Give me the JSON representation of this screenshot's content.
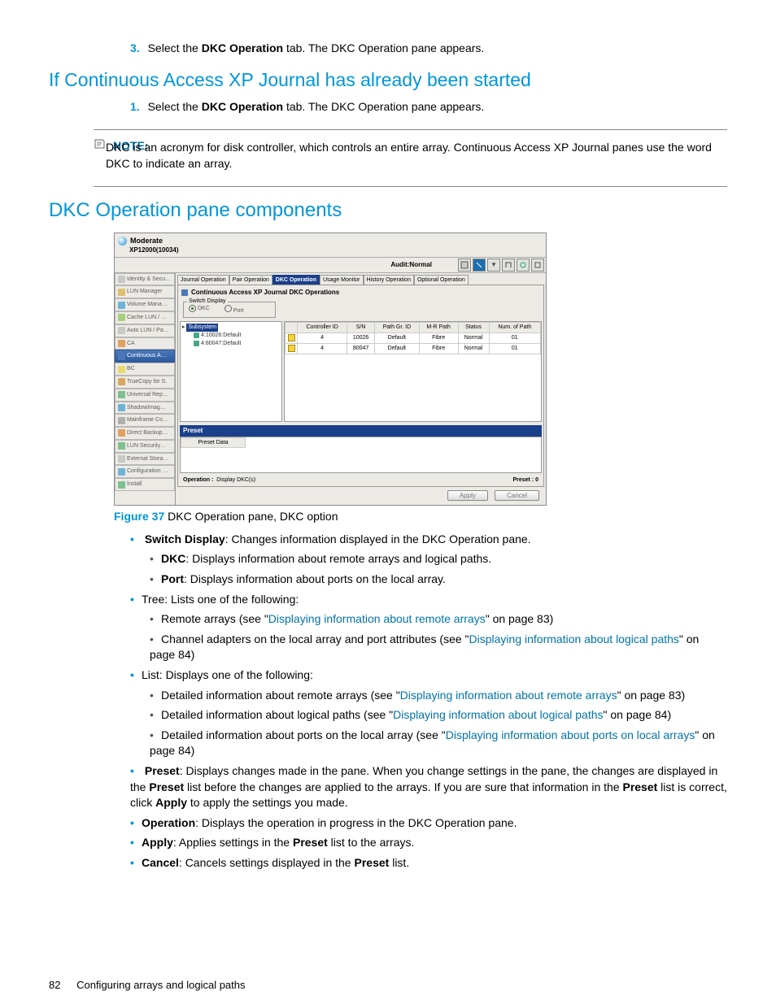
{
  "step3": {
    "num": "3.",
    "pre": "Select the ",
    "bold": "DKC Operation",
    "post": " tab. The DKC Operation pane appears."
  },
  "h2a": "If Continuous Access XP Journal has already been started",
  "step1": {
    "num": "1.",
    "pre": "Select the ",
    "bold": "DKC Operation",
    "post": " tab. The DKC Operation pane appears."
  },
  "note": {
    "label": "NOTE:",
    "text": "DKC is an acronym for disk controller, which controls an entire array. Continuous Access XP Journal panes use the word DKC to indicate an array."
  },
  "h2b": "DKC Operation pane components",
  "shot": {
    "title": "Moderate",
    "subtitle": "XP12000(10034)",
    "audit": "Audit:Normal",
    "nav": [
      "Identity & Secu…",
      "LUN Manager",
      "Volume Mana…",
      "Cache LUN / …",
      "Auto LUN / Pa…",
      "CA",
      "Continuous A…",
      "BC",
      "TrueCopy for S.",
      "Universal Rep…",
      "ShadowImag…",
      "Mainframe Co…",
      "Direct Backup…",
      "LUN Security…",
      "External Stora…",
      "Configuration …",
      "Install"
    ],
    "navActive": 6,
    "tabs": [
      "Journal Operation",
      "Pair Operation",
      "DKC Operation",
      "Usage Monitor",
      "History Operation",
      "Optional Operation"
    ],
    "tabActive": 2,
    "panelTitle": "Continuous Access XP Journal DKC Operations",
    "switch": {
      "legend": "Switch Display",
      "opts": [
        "DKC",
        "Port"
      ],
      "sel": 0
    },
    "tree": {
      "root": "Subsystem",
      "items": [
        "4:10026:Default",
        "4:80047:Default"
      ]
    },
    "table": {
      "cols": [
        "Controller ID",
        "S/N",
        "Path Gr. ID",
        "M-R Path",
        "Status",
        "Num. of Path"
      ],
      "rows": [
        [
          "4",
          "10026",
          "Default",
          "Fibre",
          "Normal",
          "01"
        ],
        [
          "4",
          "80047",
          "Default",
          "Fibre",
          "Normal",
          "01"
        ]
      ]
    },
    "preset": {
      "title": "Preset",
      "col": "Preset Data"
    },
    "op": {
      "l1": "Operation :",
      "l2": "Display DKC(s)",
      "r": "Preset : 0"
    },
    "buttons": {
      "apply": "Apply",
      "cancel": "Cancel"
    }
  },
  "figure": {
    "label": "Figure 37",
    "text": " DKC Operation pane, DKC option"
  },
  "bullets": {
    "switch": {
      "bold": "Switch Display",
      "text": ": Changes information displayed in the DKC Operation pane."
    },
    "dkc": {
      "bold": "DKC",
      "text": ": Displays information about remote arrays and logical paths."
    },
    "port": {
      "bold": "Port",
      "text": ": Displays information about ports on the local array."
    },
    "tree": "Tree: Lists one of the following:",
    "tree1": {
      "pre": "Remote arrays (see \"",
      "link": "Displaying information about remote arrays",
      "post": "\" on page 83)"
    },
    "tree2": {
      "pre": "Channel adapters on the local array and port attributes (see \"",
      "link": "Displaying information about logical paths",
      "post": "\" on page 84)"
    },
    "list": "List: Displays one of the following:",
    "list1": {
      "pre": "Detailed information about remote arrays (see \"",
      "link": "Displaying information about remote arrays",
      "post": "\" on page 83)"
    },
    "list2": {
      "pre": "Detailed information about logical paths (see \"",
      "link": "Displaying information about logical paths",
      "post": "\" on page 84)"
    },
    "list3": {
      "pre": "Detailed information about ports on the local array (see \"",
      "link": "Displaying information about ports on local arrays",
      "post": "\" on page 84)"
    },
    "preset": {
      "bold": "Preset",
      "text": ": Displays changes made in the pane. When you change settings in the pane, the changes are displayed in the ",
      "bold2": "Preset",
      "text2": " list before the changes are applied to the arrays. If you are sure that information in the ",
      "bold3": "Preset",
      "text3": " list is correct, click ",
      "bold4": "Apply",
      "text4": " to apply the settings you made."
    },
    "operation": {
      "bold": "Operation",
      "text": ": Displays the operation in progress in the DKC Operation pane."
    },
    "apply": {
      "bold": "Apply",
      "text": ": Applies settings in the ",
      "bold2": "Preset",
      "text2": " list to the arrays."
    },
    "cancel": {
      "bold": "Cancel",
      "text": ": Cancels settings displayed in the ",
      "bold2": "Preset",
      "text2": " list."
    }
  },
  "footer": {
    "page": "82",
    "chapter": "Configuring arrays and logical paths"
  }
}
